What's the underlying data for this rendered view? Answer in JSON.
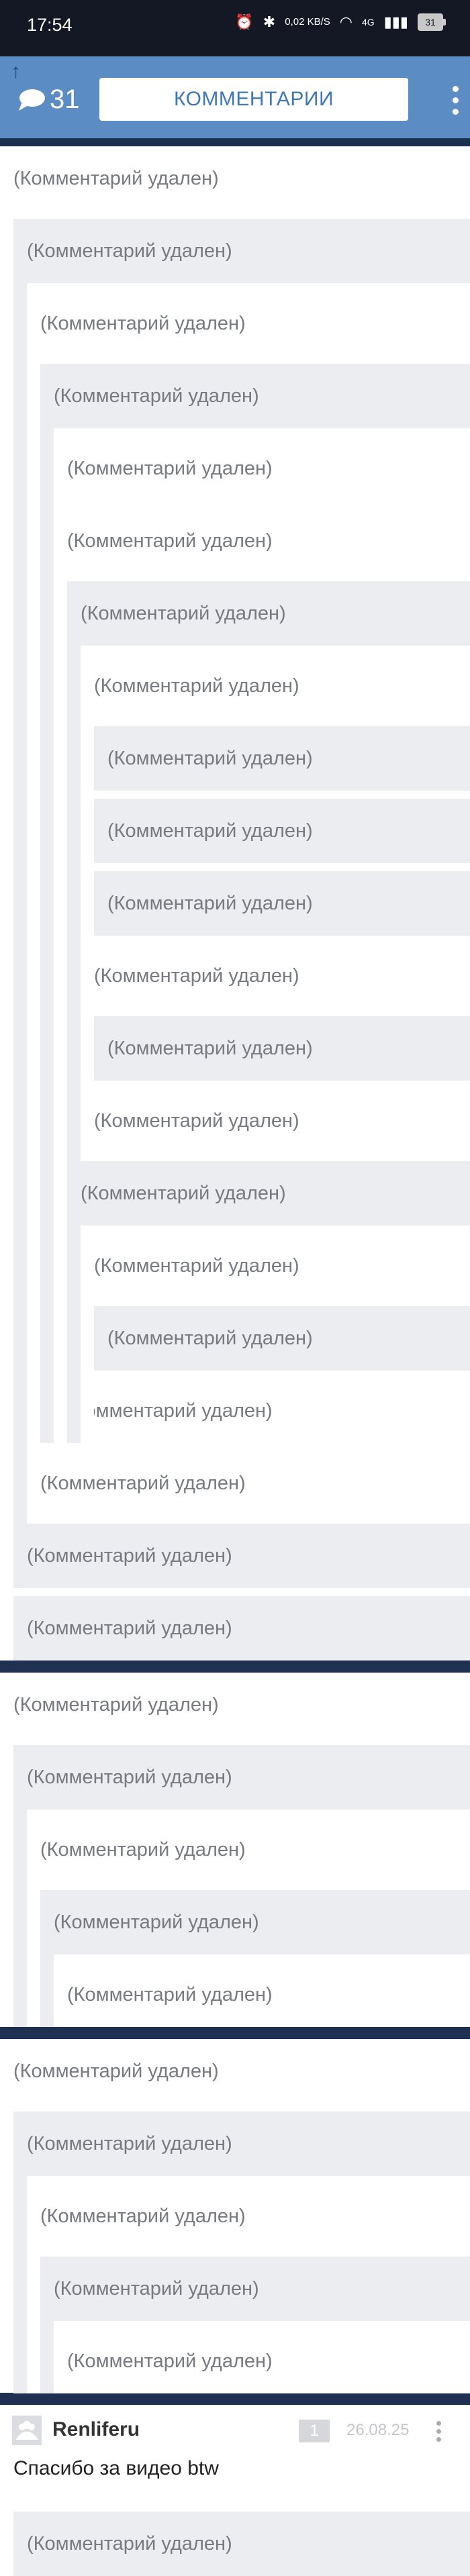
{
  "status_bar": {
    "time": "17:54",
    "speed": "0,02 KB/S",
    "network": "4G",
    "battery": "31"
  },
  "header": {
    "comment_count": "31",
    "title": "КОММЕНТАРИИ"
  },
  "deleted_text": "(Комментарий удален)",
  "thread_1": [
    {
      "text": "(Комментарий удален)"
    },
    {
      "text": "(Комментарий удален)"
    },
    {
      "text": "(Комментарий удален)"
    },
    {
      "text": "(Комментарий удален)"
    },
    {
      "text": "(Комментарий удален)"
    },
    {
      "text": "(Комментарий удален)"
    },
    {
      "text": "(Комментарий удален)"
    },
    {
      "text": "(Комментарий удален)"
    },
    {
      "text": "(Комментарий удален)"
    },
    {
      "text": "(Комментарий удален)"
    },
    {
      "text": "(Комментарий удален)"
    },
    {
      "text": "(Комментарий удален)"
    },
    {
      "text": "(Комментарий удален)"
    },
    {
      "text": "(Комментарий удален)"
    },
    {
      "text": "(Комментарий удален)"
    },
    {
      "text": "(Комментарий удален)"
    },
    {
      "text": "(Комментарий удален)"
    },
    {
      "text": "(Комментарий удален)"
    },
    {
      "text": "(Комментарий удален)"
    },
    {
      "text": "(Комментарий удален)"
    },
    {
      "text": "(Комментарий удален)"
    },
    {
      "text": "(Комментарий удален)"
    }
  ],
  "thread_2": [
    {
      "text": "(Комментарий удален)"
    },
    {
      "text": "(Комментарий удален)"
    },
    {
      "text": "(Комментарий удален)"
    },
    {
      "text": "(Комментарий удален)"
    },
    {
      "text": "(Комментарий удален)"
    }
  ],
  "thread_3": [
    {
      "text": "(Комментарий удален)"
    },
    {
      "text": "(Комментарий удален)"
    },
    {
      "text": "(Комментарий удален)"
    },
    {
      "text": "(Комментарий удален)"
    },
    {
      "text": "(Комментарий удален)"
    }
  ],
  "user_comment": {
    "username": "Renliferu",
    "rating": "1",
    "date": "26.08.25",
    "text": "Спасибо за видео btw"
  },
  "reply": {
    "text": "(Комментарий удален)"
  },
  "colors": {
    "header_bg": "#5b8cc4",
    "divider": "#1f3150",
    "row_gray": "#ecedf0",
    "deleted_text": "#777a80",
    "title_text": "#3e78b6"
  }
}
